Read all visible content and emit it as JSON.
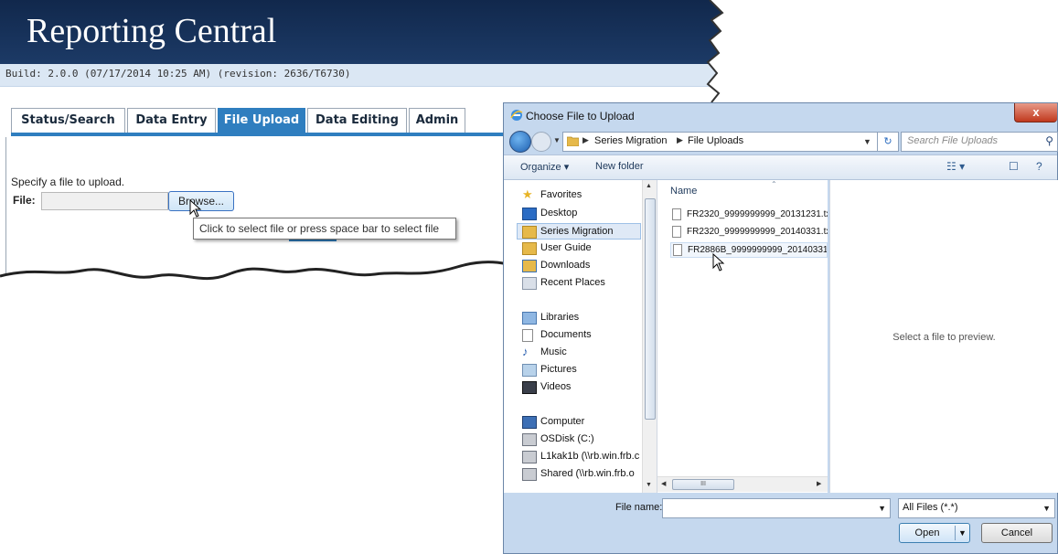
{
  "web_page": {
    "title": "Reporting Central",
    "build_info": "Build: 2.0.0 (07/17/2014 10:25 AM) (revision: 2636/T6730)",
    "tabs": [
      {
        "label": "Status/Search"
      },
      {
        "label": "Data Entry"
      },
      {
        "label": "File Upload",
        "active": true
      },
      {
        "label": "Data Editing"
      },
      {
        "label": "Admin"
      }
    ],
    "instruction": "Specify a file to upload.",
    "file_label": "File:",
    "file_value": "",
    "browse_label": "Browse...",
    "tooltip": "Click to select file or press space bar to select file"
  },
  "dialog": {
    "title": "Choose File to Upload",
    "close_label": "x",
    "address": {
      "crumbs": [
        "Series Migration",
        "File Uploads"
      ]
    },
    "search_placeholder": "Search File Uploads",
    "toolbar": {
      "organize": "Organize ▾",
      "new_folder": "New folder"
    },
    "nav": {
      "favorites": {
        "label": "Favorites",
        "items": [
          "Desktop",
          "Series Migration",
          "User Guide",
          "Downloads",
          "Recent Places"
        ]
      },
      "libraries": {
        "label": "Libraries",
        "items": [
          "Documents",
          "Music",
          "Pictures",
          "Videos"
        ]
      },
      "computer": {
        "label": "Computer",
        "items": [
          "OSDisk (C:)",
          "L1kak1b (\\\\rb.win.frb.c",
          "Shared (\\\\rb.win.frb.o"
        ]
      }
    },
    "column_name": "Name",
    "files": [
      "FR2320_9999999999_20131231.tx",
      "FR2320_9999999999_20140331.tx",
      "FR2886B_9999999999_20140331."
    ],
    "scroll_thumb": "III",
    "preview_text": "Select a file to preview.",
    "file_name_label": "File name:",
    "file_name_value": "",
    "filter_value": "All Files (*.*)",
    "open_label": "Open",
    "cancel_label": "Cancel"
  },
  "colors": {
    "banner": "#11284c",
    "tab_active": "#2f7ebf",
    "close": "#c0391e"
  }
}
